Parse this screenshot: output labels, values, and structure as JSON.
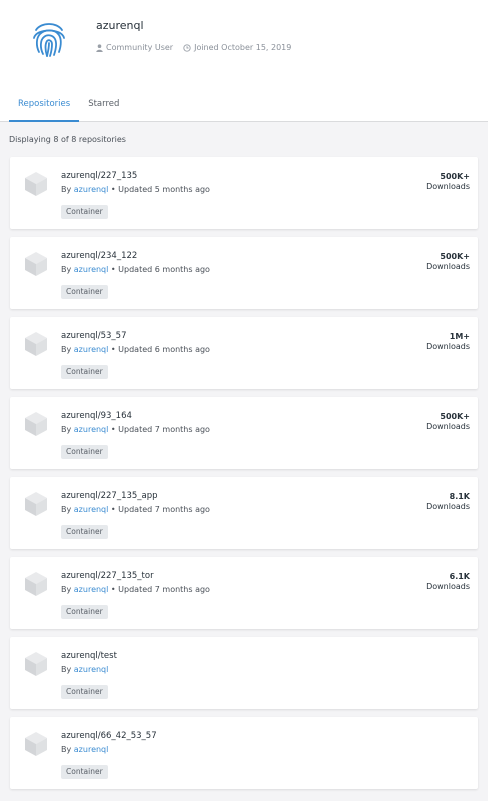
{
  "profile": {
    "username": "azurenql",
    "role": "Community User",
    "joined": "Joined October 15, 2019",
    "avatar_icon": "fingerprint-icon",
    "avatar_color": "#3a8bd1"
  },
  "tabs": [
    {
      "label": "Repositories",
      "active": true
    },
    {
      "label": "Starred",
      "active": false
    }
  ],
  "summary": "Displaying 8 of 8 repositories",
  "repositories": [
    {
      "name": "azurenql/227_135",
      "by": "By",
      "owner": "azurenql",
      "updated": "• Updated 5 months ago",
      "type": "Container",
      "downloads": "500K+",
      "downloads_label": "Downloads"
    },
    {
      "name": "azurenql/234_122",
      "by": "By",
      "owner": "azurenql",
      "updated": "• Updated 6 months ago",
      "type": "Container",
      "downloads": "500K+",
      "downloads_label": "Downloads"
    },
    {
      "name": "azurenql/53_57",
      "by": "By",
      "owner": "azurenql",
      "updated": "• Updated 6 months ago",
      "type": "Container",
      "downloads": "1M+",
      "downloads_label": "Downloads"
    },
    {
      "name": "azurenql/93_164",
      "by": "By",
      "owner": "azurenql",
      "updated": "• Updated 7 months ago",
      "type": "Container",
      "downloads": "500K+",
      "downloads_label": "Downloads"
    },
    {
      "name": "azurenql/227_135_app",
      "by": "By",
      "owner": "azurenql",
      "updated": "• Updated 7 months ago",
      "type": "Container",
      "downloads": "8.1K",
      "downloads_label": "Downloads"
    },
    {
      "name": "azurenql/227_135_tor",
      "by": "By",
      "owner": "azurenql",
      "updated": "• Updated 7 months ago",
      "type": "Container",
      "downloads": "6.1K",
      "downloads_label": "Downloads"
    },
    {
      "name": "azurenql/test",
      "by": "By",
      "owner": "azurenql",
      "updated": "",
      "type": "Container",
      "downloads": "",
      "downloads_label": ""
    },
    {
      "name": "azurenql/66_42_53_57",
      "by": "By",
      "owner": "azurenql",
      "updated": "",
      "type": "Container",
      "downloads": "",
      "downloads_label": ""
    }
  ]
}
